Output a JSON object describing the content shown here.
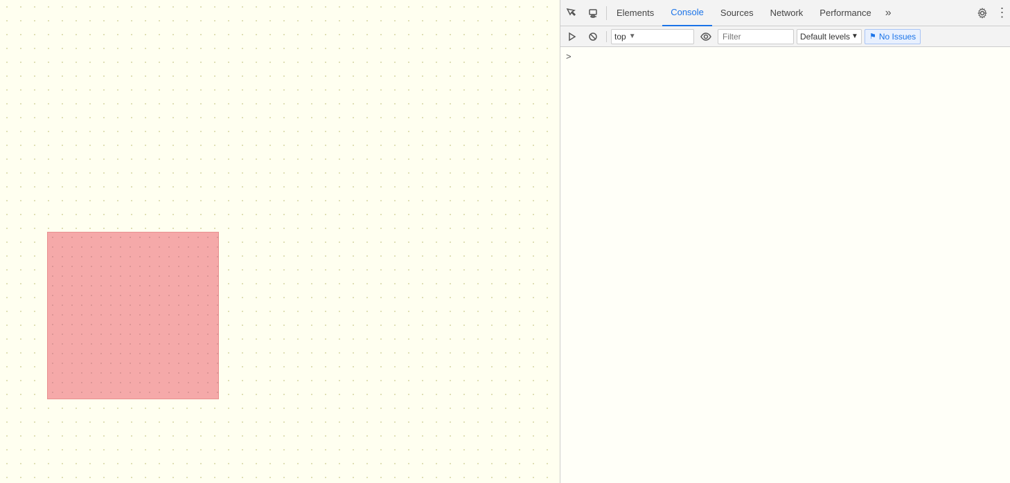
{
  "devtools": {
    "tabs": [
      {
        "id": "elements",
        "label": "Elements",
        "active": false
      },
      {
        "id": "console",
        "label": "Console",
        "active": true
      },
      {
        "id": "sources",
        "label": "Sources",
        "active": false
      },
      {
        "id": "network",
        "label": "Network",
        "active": false
      },
      {
        "id": "performance",
        "label": "Performance",
        "active": false
      }
    ],
    "toolbar": {
      "inspect_icon": "⬚",
      "device_icon": "⬜",
      "overflow_label": "»",
      "gear_label": "⚙",
      "more_label": "⋮"
    },
    "console_toolbar": {
      "clear_icon": "🚫",
      "play_icon": "▶",
      "context_value": "top",
      "eye_icon": "👁",
      "filter_placeholder": "Filter",
      "levels_label": "Default levels",
      "no_issues_label": "No Issues"
    },
    "console_prompt": ">"
  }
}
